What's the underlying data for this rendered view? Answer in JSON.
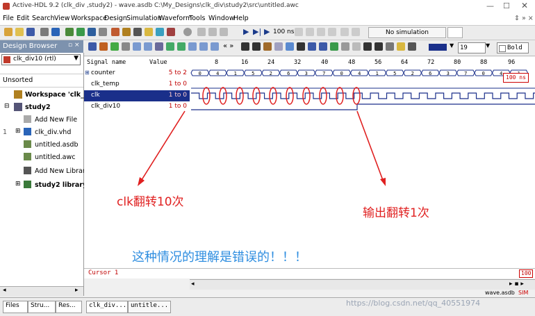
{
  "window": {
    "title": "Active-HDL 9.2 (clk_div ,study2) - wave.asdb C:\\My_Designs\\clk_div\\study2\\src\\untitled.awc"
  },
  "menu": [
    "File",
    "Edit",
    "Search",
    "View",
    "Workspace",
    "Design",
    "Simulation",
    "Waveform",
    "Tools",
    "Window",
    "Help"
  ],
  "toolbar": {
    "sim_time": "100 ns",
    "status": "No simulation"
  },
  "wave_toolbar": {
    "zoom": "19",
    "bold": "Bold"
  },
  "design_browser": {
    "title": "Design Browser",
    "top_unit": "clk_div10 (rtl)",
    "sort": "Unsorted",
    "items": [
      {
        "label": "Workspace 'clk_div':"
      },
      {
        "label": "study2"
      },
      {
        "label": "Add New File"
      },
      {
        "label": "clk_div.vhd"
      },
      {
        "label": "untitled.asdb"
      },
      {
        "label": "untitled.awc"
      },
      {
        "label": "Add New Library"
      },
      {
        "label": "study2 library"
      }
    ],
    "tree_index": "1"
  },
  "wave": {
    "signal_header": "Signal name",
    "value_header": "Value",
    "ticks": [
      "8",
      "16",
      "24",
      "32",
      "40",
      "48",
      "56",
      "64",
      "72",
      "80",
      "88",
      "96"
    ],
    "time_label": "100 ns",
    "signals": [
      {
        "name": "counter",
        "value": "5 to 2"
      },
      {
        "name": "clk_temp",
        "value": "1 to 0"
      },
      {
        "name": "clk",
        "value": "1 to 0"
      },
      {
        "name": "clk_div10",
        "value": "1 to 0"
      }
    ],
    "counter_values": [
      "0",
      "4",
      "1",
      "5",
      "2",
      "6",
      "3",
      "7",
      "0",
      "4",
      "1",
      "5",
      "2",
      "6",
      "3",
      "7",
      "0",
      "4",
      "1"
    ],
    "cursor_label": "Cursor 1",
    "cursor_value": "100"
  },
  "annotations": {
    "clk_toggle": "clk翻转10次",
    "output_toggle": "输出翻转1次",
    "wrong": "这种情况的理解是错误的！！！"
  },
  "bottom_tabs": {
    "left": [
      "Files",
      "Stru...",
      "Res..."
    ],
    "right": [
      "clk_div...",
      "untitle..."
    ],
    "status": "wave.asdb",
    "sim": "SIM"
  },
  "watermark": "https://blog.csdn.net/qq_40551974"
}
